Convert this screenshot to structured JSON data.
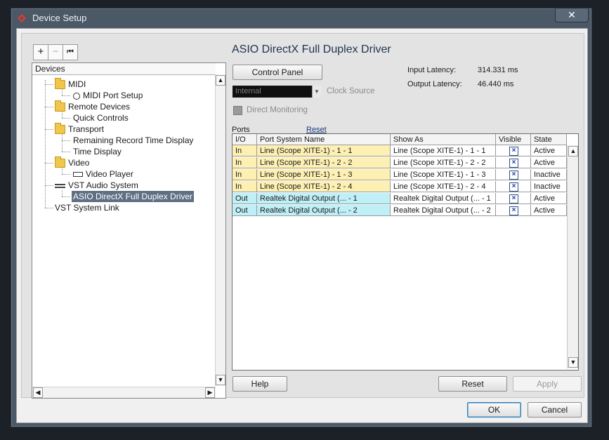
{
  "window": {
    "title": "Device Setup",
    "close_glyph": "✕"
  },
  "toolbar": {
    "add": "+",
    "remove": "−",
    "reset": "⏮"
  },
  "tree": {
    "header": "Devices",
    "items": [
      {
        "label": "MIDI",
        "icon": "folder-icon"
      },
      {
        "label": "MIDI Port Setup",
        "icon": "midi-port-icon"
      },
      {
        "label": "Remote Devices",
        "icon": "folder-icon"
      },
      {
        "label": "Quick Controls",
        "icon": ""
      },
      {
        "label": "Transport",
        "icon": "folder-icon"
      },
      {
        "label": "Remaining Record Time Display",
        "icon": ""
      },
      {
        "label": "Time Display",
        "icon": ""
      },
      {
        "label": "Video",
        "icon": "folder-icon"
      },
      {
        "label": "Video Player",
        "icon": "video-player-icon"
      },
      {
        "label": "VST Audio System",
        "icon": "audio-system-icon"
      },
      {
        "label": "ASIO DirectX Full Duplex Driver",
        "icon": "",
        "selected": true
      },
      {
        "label": "VST System Link",
        "icon": ""
      }
    ]
  },
  "panel": {
    "title": "ASIO DirectX Full Duplex Driver",
    "control_panel": "Control Panel",
    "input_latency_label": "Input Latency:",
    "input_latency_value": "314.331 ms",
    "output_latency_label": "Output Latency:",
    "output_latency_value": "46.440 ms",
    "clock_value": "Internal",
    "clock_label": "Clock Source",
    "direct_monitoring": "Direct Monitoring",
    "ports_label": "Ports",
    "reset_link": "Reset"
  },
  "ports": {
    "columns": [
      "I/O",
      "Port System Name",
      "Show As",
      "Visible",
      "State"
    ],
    "rows": [
      {
        "io": "In",
        "name": "Line (Scope XITE-1) - 1 - 1",
        "show": "Line (Scope XITE-1) - 1 - 1",
        "visible": "×",
        "state": "Active"
      },
      {
        "io": "In",
        "name": "Line (Scope XITE-1) - 2 - 2",
        "show": "Line (Scope XITE-1) - 2 - 2",
        "visible": "×",
        "state": "Active"
      },
      {
        "io": "In",
        "name": "Line (Scope XITE-1) - 1 - 3",
        "show": "Line (Scope XITE-1) - 1 - 3",
        "visible": "×",
        "state": "Inactive"
      },
      {
        "io": "In",
        "name": "Line (Scope XITE-1) - 2 - 4",
        "show": "Line (Scope XITE-1) - 2 - 4",
        "visible": "×",
        "state": "Inactive"
      },
      {
        "io": "Out",
        "name": "Realtek Digital Output (... - 1",
        "show": "Realtek Digital Output (... - 1",
        "visible": "×",
        "state": "Active"
      },
      {
        "io": "Out",
        "name": "Realtek Digital Output (... - 2",
        "show": "Realtek Digital Output (... - 2",
        "visible": "×",
        "state": "Active"
      }
    ]
  },
  "buttons": {
    "help": "Help",
    "reset": "Reset",
    "apply": "Apply",
    "ok": "OK",
    "cancel": "Cancel"
  },
  "colors": {
    "in_row": "#fdf0b2",
    "out_row": "#bff0f7",
    "selection": "#5f6f84",
    "accent": "#e23a2e"
  }
}
